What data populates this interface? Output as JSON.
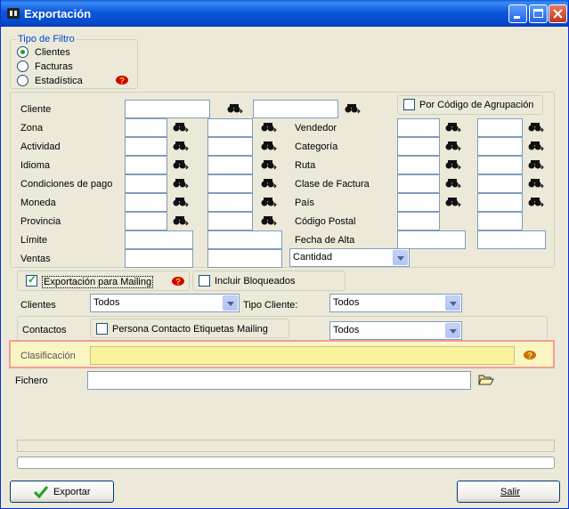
{
  "window": {
    "title": "Exportación"
  },
  "filter_group": {
    "title": "Tipo de Filtro",
    "options": [
      "Clientes",
      "Facturas",
      "Estadística"
    ],
    "selected": "Clientes"
  },
  "fields": {
    "cliente": "Cliente",
    "zona": "Zona",
    "actividad": "Actividad",
    "idioma": "Idioma",
    "condiciones_pago": "Condiciones de pago",
    "moneda": "Moneda",
    "provincia": "Provincia",
    "limite": "Límite",
    "ventas": "Ventas",
    "vendedor": "Vendedor",
    "categoria": "Categoría",
    "ruta": "Ruta",
    "clase_factura": "Clase de Factura",
    "pais": "País",
    "codigo_postal": "Código Postal",
    "fecha_alta": "Fecha de Alta"
  },
  "por_codigo": {
    "label": "Por Código de Agrupación",
    "checked": false
  },
  "ventas_combo": {
    "value": "Cantidad"
  },
  "mailing": {
    "label": "Exportación para Mailing",
    "checked": true
  },
  "bloqueados": {
    "label": "Incluir Bloqueados",
    "checked": false
  },
  "clientes_row": {
    "label": "Clientes",
    "value": "Todos"
  },
  "tipo_cliente": {
    "label": "Tipo Cliente:",
    "value": "Todos"
  },
  "contactos": {
    "label": "Contactos",
    "checkbox_label": "Persona Contacto Etiquetas Mailing",
    "checked": false,
    "value": "Todos"
  },
  "clasificacion": {
    "label": "Clasificación",
    "value": ""
  },
  "fichero": {
    "label": "Fichero",
    "value": ""
  },
  "buttons": {
    "export": "Exportar",
    "exit": "Salir"
  },
  "colors": {
    "titlebar": "#0A58DA",
    "highlight_border": "#F29B9B",
    "highlight_bg": "#FBF5C2",
    "dialog_bg": "#ECE9D8"
  }
}
